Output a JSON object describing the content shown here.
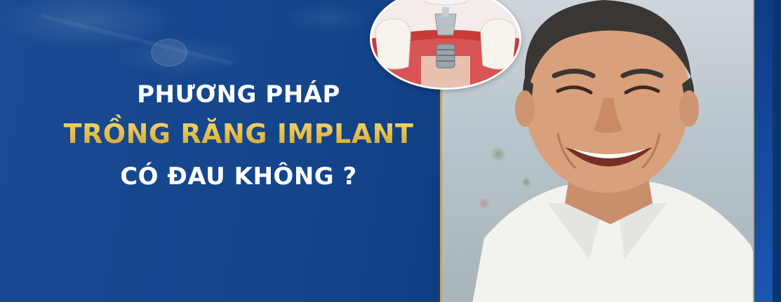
{
  "headline": {
    "line1": "PHƯƠNG PHÁP",
    "line2": "TRỒNG RĂNG IMPLANT",
    "line3": "CÓ ĐAU KHÔNG ?"
  },
  "colors": {
    "background": "#15468c",
    "accent_gold": "#e6bf4a",
    "text_white": "#ffffff"
  },
  "images": {
    "implant": "dental-implant-illustration",
    "portrait": "smiling-man-photo"
  }
}
